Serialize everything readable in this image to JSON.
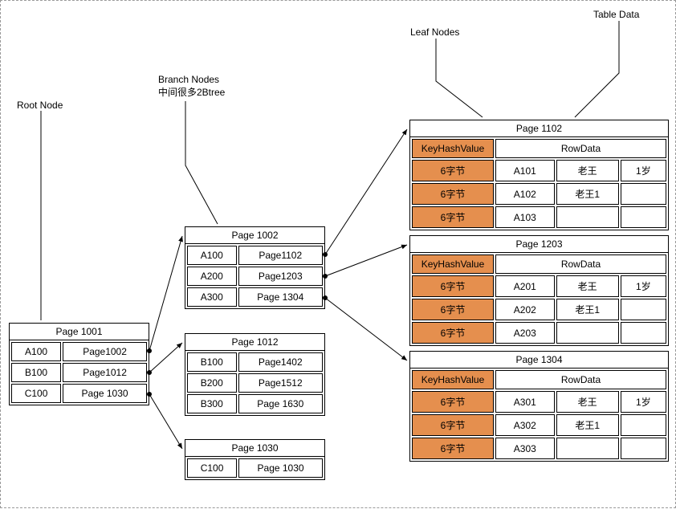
{
  "labels": {
    "root": "Root Node",
    "branch1": "Branch Nodes",
    "branch2": "中间很多2Btree",
    "leaf": "Leaf Nodes",
    "tabledata": "Table Data"
  },
  "root": {
    "title": "Page 1001",
    "rows": [
      {
        "k": "A100",
        "p": "Page1002"
      },
      {
        "k": "B100",
        "p": "Page1012"
      },
      {
        "k": "C100",
        "p": "Page 1030"
      }
    ]
  },
  "branch1002": {
    "title": "Page 1002",
    "rows": [
      {
        "k": "A100",
        "p": "Page1102"
      },
      {
        "k": "A200",
        "p": "Page1203"
      },
      {
        "k": "A300",
        "p": "Page 1304"
      }
    ]
  },
  "branch1012": {
    "title": "Page 1012",
    "rows": [
      {
        "k": "B100",
        "p": "Page1402"
      },
      {
        "k": "B200",
        "p": "Page1512"
      },
      {
        "k": "B300",
        "p": "Page 1630"
      }
    ]
  },
  "branch1030": {
    "title": "Page 1030",
    "rows": [
      {
        "k": "C100",
        "p": "Page 1030"
      }
    ]
  },
  "leafHdr": {
    "khv": "KeyHashValue",
    "row": "RowData",
    "byte": "6字节"
  },
  "leaf1102": {
    "title": "Page 1102",
    "rows": [
      {
        "c1": "A101",
        "c2": "老王",
        "c3": "1岁"
      },
      {
        "c1": "A102",
        "c2": "老王1",
        "c3": ""
      },
      {
        "c1": "A103",
        "c2": "",
        "c3": ""
      }
    ]
  },
  "leaf1203": {
    "title": "Page 1203",
    "rows": [
      {
        "c1": "A201",
        "c2": "老王",
        "c3": "1岁"
      },
      {
        "c1": "A202",
        "c2": "老王1",
        "c3": ""
      },
      {
        "c1": "A203",
        "c2": "",
        "c3": ""
      }
    ]
  },
  "leaf1304": {
    "title": "Page 1304",
    "rows": [
      {
        "c1": "A301",
        "c2": "老王",
        "c3": "1岁"
      },
      {
        "c1": "A302",
        "c2": "老王1",
        "c3": ""
      },
      {
        "c1": "A303",
        "c2": "",
        "c3": ""
      }
    ]
  }
}
